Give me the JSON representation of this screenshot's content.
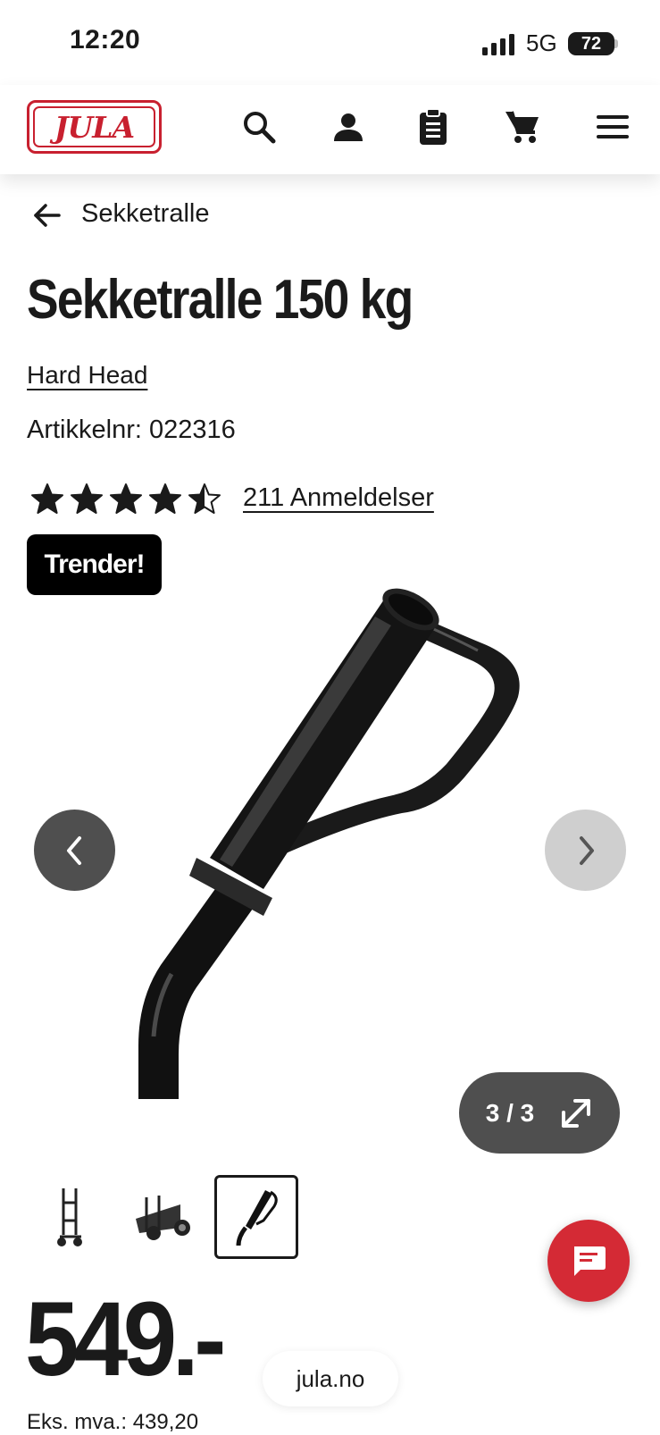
{
  "status_bar": {
    "time": "12:20",
    "network": "5G",
    "battery": "72"
  },
  "header": {
    "logo_text": "JULA",
    "icons": [
      "search-icon",
      "account-icon",
      "clipboard-icon",
      "cart-icon",
      "menu-icon"
    ]
  },
  "breadcrumb": {
    "label": "Sekketralle"
  },
  "product": {
    "title": "Sekketralle 150 kg",
    "brand": "Hard Head",
    "sku": "Artikkelnr: 022316",
    "rating": 4.5,
    "rating_max": 5,
    "reviews": "211 Anmeldelser",
    "badge": "Trender!"
  },
  "gallery": {
    "counter": "3 / 3",
    "current": 3,
    "total": 3,
    "thumbnail_count": 3
  },
  "price": {
    "value": "549.-",
    "ex_vat": "Eks. mva.: 439,20"
  },
  "url": "jula.no",
  "colors": {
    "brand_red": "#c8202f",
    "chat_red": "#d42a35",
    "text": "#1a1a1a"
  }
}
